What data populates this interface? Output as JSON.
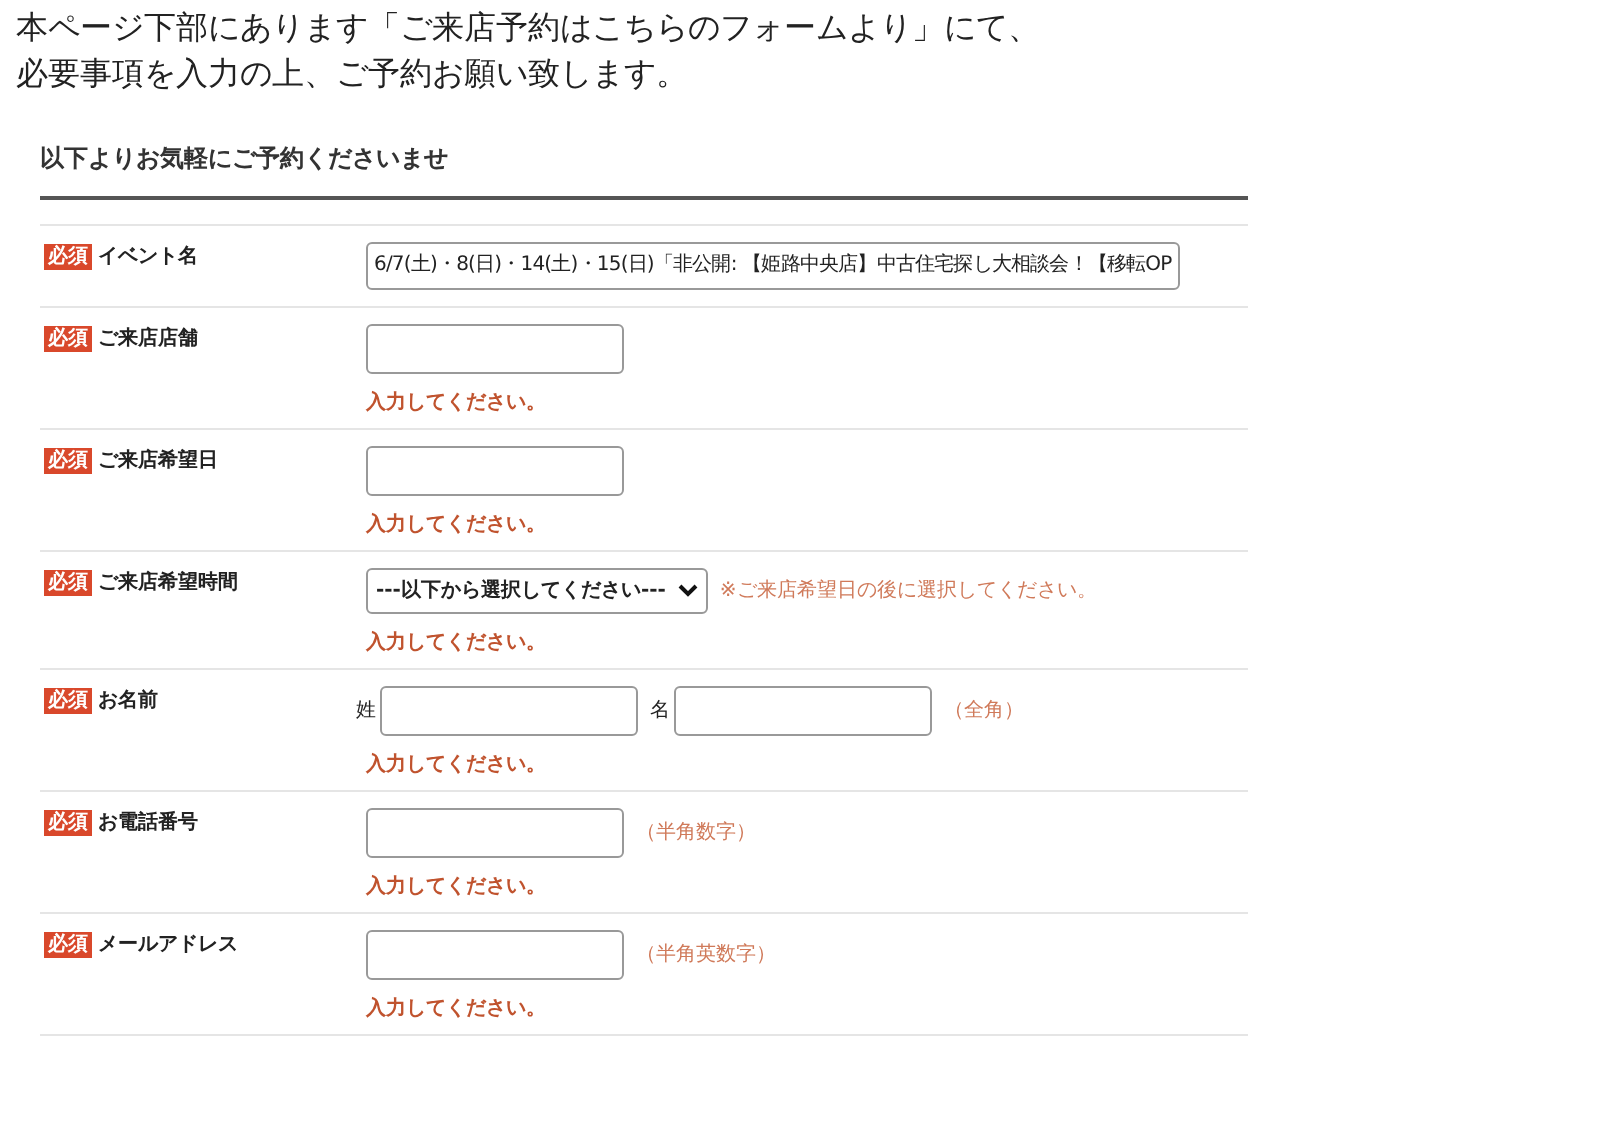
{
  "intro": [
    "本ページ下部にあります「ご来店予約はこちらのフォームより」にて、",
    "必要事項を入力の上、ご予約お願い致します。"
  ],
  "form": {
    "title": "以下よりお気軽にご予約くださいませ",
    "rows": [
      {
        "kind": "text",
        "badge": "必須",
        "label": "イベント名",
        "value": "6/7(土)・8(日)・14(土)・15(日)「非公開: 【姫路中央店】中古住宅探し大相談会！【移転OP"
      },
      {
        "kind": "input",
        "badge": "必須",
        "label": "ご来店店舗",
        "error": "入力してください。"
      },
      {
        "kind": "input",
        "badge": "必須",
        "label": "ご来店希望日",
        "error": "入力してください。"
      },
      {
        "kind": "select",
        "badge": "必須",
        "label": "ご来店希望時間",
        "value": "---以下から選択してください---",
        "hint": "※ご来店希望日の後に選択してください。",
        "error": "入力してください。"
      },
      {
        "kind": "name",
        "badge": "必須",
        "label": "お名前",
        "sub_labels": [
          "姓",
          "名"
        ],
        "hint": "（全角）",
        "error": "入力してください。"
      },
      {
        "kind": "input",
        "badge": "必須",
        "label": "お電話番号",
        "hint": "（半角数字）",
        "error": "入力してください。"
      },
      {
        "kind": "input",
        "badge": "必須",
        "label": "メールアドレス",
        "hint": "（半角英数字）",
        "error": "入力してください。"
      }
    ]
  }
}
